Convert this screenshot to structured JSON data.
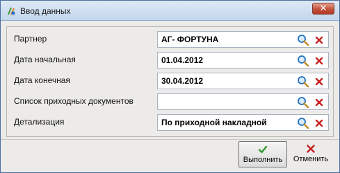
{
  "window": {
    "title": "Ввод данных",
    "close_label": "✕"
  },
  "form": {
    "rows": [
      {
        "label": "Партнер",
        "value": "АГ- ФОРТУНА"
      },
      {
        "label": "Дата начальная",
        "value": "01.04.2012"
      },
      {
        "label": "Дата конечная",
        "value": "30.04.2012"
      },
      {
        "label": "Список приходных документов",
        "value": ""
      },
      {
        "label": "Детализация",
        "value": "По приходной накладной"
      }
    ]
  },
  "buttons": {
    "execute": "Выполнить",
    "cancel": "Отменить"
  },
  "colors": {
    "search": "#1f6fbf",
    "clear": "#c81e1e",
    "execute_check": "#2e9a2e",
    "cancel_x": "#c81e1e"
  }
}
